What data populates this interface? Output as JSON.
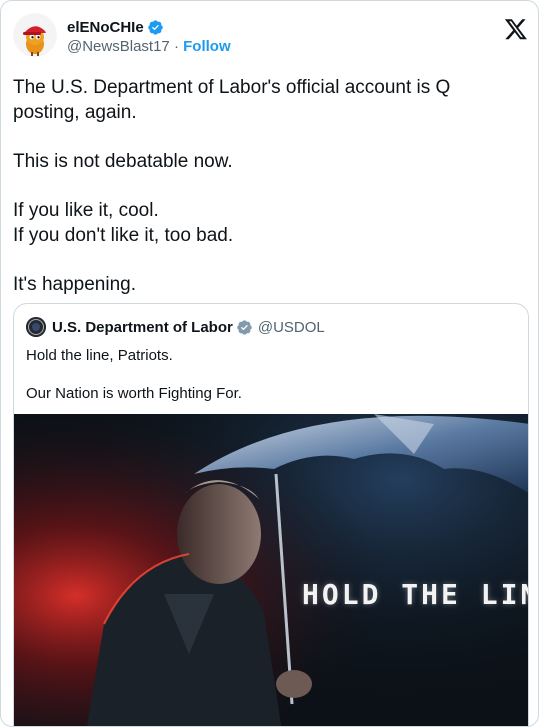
{
  "tweet": {
    "author": {
      "display_name": "elENoCHIe",
      "handle": "@NewsBlast17",
      "separator": "·",
      "follow_label": "Follow"
    },
    "text_lines": [
      "The U.S. Department of Labor's official account is Q posting, again.",
      "This is not debatable now.",
      "If you like it, cool.",
      "If you don't like it, too bad.",
      "It's happening."
    ],
    "logo_icon": "x-logo-icon"
  },
  "quote": {
    "author": {
      "display_name": "U.S. Department of Labor",
      "handle": "@USDOL"
    },
    "text_lines": [
      "Hold the line, Patriots.",
      "Our Nation is worth Fighting For."
    ],
    "image": {
      "overlay_text": "HOLD THE LINE."
    }
  },
  "colors": {
    "accent": "#1d9bf0",
    "secondary_text": "#536471",
    "border": "#cfd9de",
    "verified_blue": "#1d9bf0",
    "verified_gov_gray": "#829aab"
  }
}
